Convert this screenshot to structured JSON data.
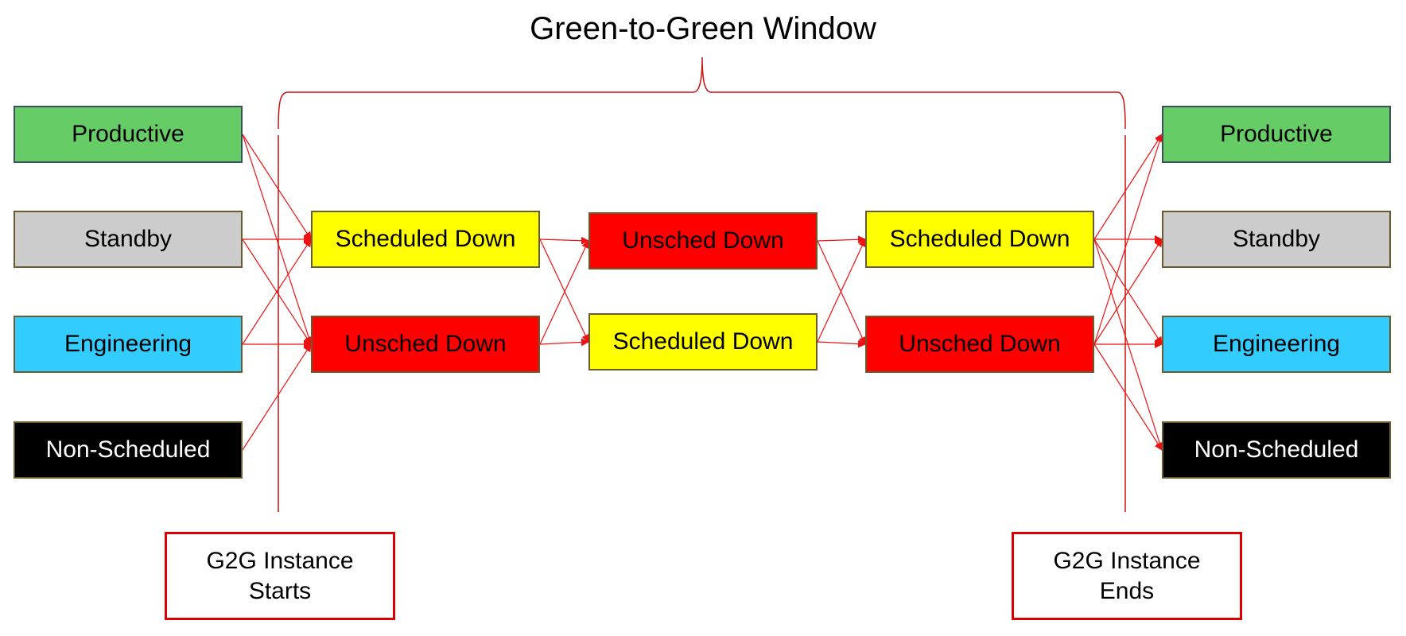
{
  "title": "Green-to-Green Window",
  "colors": {
    "productive": "#66cc66",
    "standby": "#cccccc",
    "engineering": "#33ccff",
    "non_scheduled": "#000000",
    "scheduled_down": "#ffff00",
    "unsched_down": "#ff0000",
    "arrow": "#ee1111",
    "bracket": "#cc1111"
  },
  "columns": {
    "start_states": [
      {
        "id": "L-productive",
        "label": "Productive",
        "state": "productive"
      },
      {
        "id": "L-standby",
        "label": "Standby",
        "state": "standby"
      },
      {
        "id": "L-engineering",
        "label": "Engineering",
        "state": "engineering"
      },
      {
        "id": "L-nonsched",
        "label": "Non-Scheduled",
        "state": "non_scheduled"
      }
    ],
    "down_1": [
      {
        "id": "D1-sched",
        "label": "Scheduled Down",
        "state": "scheduled_down"
      },
      {
        "id": "D1-unsched",
        "label": "Unsched Down",
        "state": "unsched_down"
      }
    ],
    "down_2": [
      {
        "id": "D2-unsched",
        "label": "Unsched Down",
        "state": "unsched_down"
      },
      {
        "id": "D2-sched",
        "label": "Scheduled Down",
        "state": "scheduled_down"
      }
    ],
    "down_3": [
      {
        "id": "D3-sched",
        "label": "Scheduled Down",
        "state": "scheduled_down"
      },
      {
        "id": "D3-unsched",
        "label": "Unsched Down",
        "state": "unsched_down"
      }
    ],
    "end_states": [
      {
        "id": "R-productive",
        "label": "Productive",
        "state": "productive"
      },
      {
        "id": "R-standby",
        "label": "Standby",
        "state": "standby"
      },
      {
        "id": "R-engineering",
        "label": "Engineering",
        "state": "engineering"
      },
      {
        "id": "R-nonsched",
        "label": "Non-Scheduled",
        "state": "non_scheduled"
      }
    ]
  },
  "edges": [
    [
      "L-productive",
      "D1-sched"
    ],
    [
      "L-productive",
      "D1-unsched"
    ],
    [
      "L-standby",
      "D1-sched"
    ],
    [
      "L-standby",
      "D1-unsched"
    ],
    [
      "L-engineering",
      "D1-sched"
    ],
    [
      "L-engineering",
      "D1-unsched"
    ],
    [
      "L-nonsched",
      "D1-unsched"
    ],
    [
      "D1-sched",
      "D2-unsched"
    ],
    [
      "D1-sched",
      "D2-sched"
    ],
    [
      "D1-unsched",
      "D2-unsched"
    ],
    [
      "D1-unsched",
      "D2-sched"
    ],
    [
      "D2-unsched",
      "D3-sched"
    ],
    [
      "D2-unsched",
      "D3-unsched"
    ],
    [
      "D2-sched",
      "D3-sched"
    ],
    [
      "D2-sched",
      "D3-unsched"
    ],
    [
      "D3-sched",
      "R-productive"
    ],
    [
      "D3-sched",
      "R-standby"
    ],
    [
      "D3-sched",
      "R-engineering"
    ],
    [
      "D3-sched",
      "R-nonsched"
    ],
    [
      "D3-unsched",
      "R-productive"
    ],
    [
      "D3-unsched",
      "R-standby"
    ],
    [
      "D3-unsched",
      "R-engineering"
    ],
    [
      "D3-unsched",
      "R-nonsched"
    ]
  ],
  "notes": {
    "start": {
      "line1": "G2G Instance",
      "line2": "Starts"
    },
    "end": {
      "line1": "G2G Instance",
      "line2": "Ends"
    }
  }
}
